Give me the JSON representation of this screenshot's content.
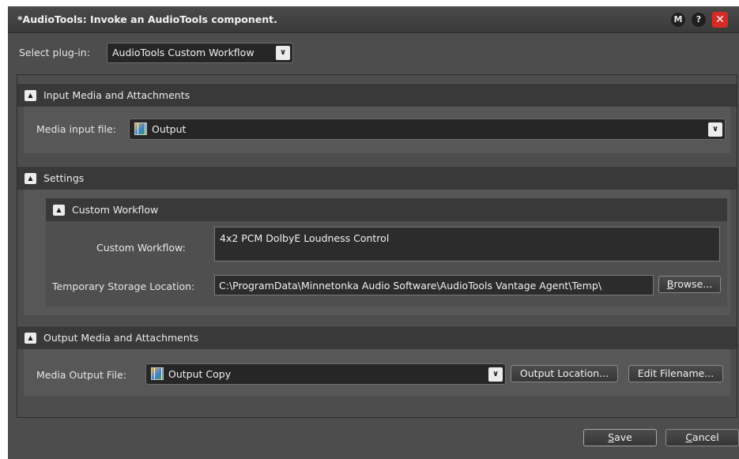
{
  "window": {
    "title": "*AudioTools: Invoke an AudioTools component.",
    "buttons": {
      "m": "M",
      "help": "?",
      "close": "✕"
    }
  },
  "plugin": {
    "label": "Select plug-in:",
    "value": "AudioTools Custom Workflow"
  },
  "input_section": {
    "title": "Input Media and Attachments",
    "media_label": "Media input file:",
    "media_value": "Output"
  },
  "settings_section": {
    "title": "Settings",
    "custom_workflow": {
      "title": "Custom Workflow",
      "workflow_label": "Custom Workflow:",
      "workflow_value": "4x2 PCM DolbyE Loudness Control",
      "storage_label": "Temporary Storage Location:",
      "storage_value": "C:\\ProgramData\\Minnetonka Audio Software\\AudioTools Vantage Agent\\Temp\\",
      "browse_prefix": "B",
      "browse_rest": "rowse..."
    }
  },
  "output_section": {
    "title": "Output Media and Attachments",
    "media_label": "Media Output File:",
    "media_value": "Output Copy",
    "location_button": "Output Location...",
    "filename_button": "Edit Filename..."
  },
  "footer": {
    "save_prefix": "S",
    "save_rest": "ave",
    "cancel_prefix": "C",
    "cancel_rest": "ancel"
  },
  "icons": {
    "expand": "expand-up-icon",
    "dropdown": "chevron-down-icon",
    "media": "media-file-icon"
  },
  "colors": {
    "window_bg": "#4d4d4d",
    "header_bg": "#393939",
    "close_red": "#d62a23"
  }
}
